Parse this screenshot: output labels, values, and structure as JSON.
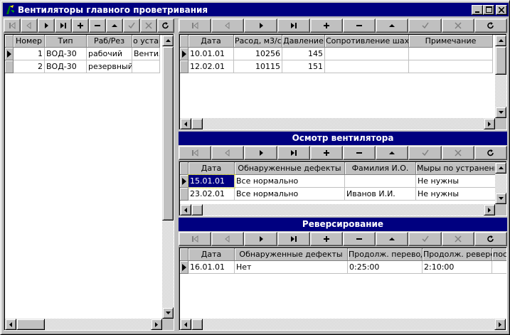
{
  "window": {
    "title": "Вентиляторы главного проветривания",
    "icon": "fan-app-icon",
    "controls": [
      "minimize-icon",
      "maximize-icon",
      "close-icon"
    ]
  },
  "nav_icons": [
    "first-record-icon",
    "prior-record-icon",
    "next-record-icon",
    "last-record-icon",
    "insert-record-icon",
    "delete-record-icon",
    "edit-record-icon",
    "post-edit-icon",
    "cancel-edit-icon",
    "refresh-icon"
  ],
  "fans": {
    "columns": [
      "Номер",
      "Тип",
      "Раб/Рез",
      "о установ"
    ],
    "rows": [
      [
        "1",
        "ВОД-30",
        "рабочий",
        "Вентил"
      ],
      [
        "2",
        "ВОД-30",
        "резервный",
        ""
      ]
    ]
  },
  "measurements": {
    "columns": [
      "Дата",
      "Расод, м3/с",
      "Давление",
      "Сопротивление шахты",
      "Примечание"
    ],
    "rows": [
      [
        "10.01.01",
        "10256",
        "145",
        "",
        ""
      ],
      [
        "12.02.01",
        "10115",
        "151",
        "",
        ""
      ]
    ]
  },
  "inspection": {
    "title": "Осмотр вентилятора",
    "columns": [
      "Дата",
      "Обнаруженные дефекты",
      "Фамилия И.О.",
      "Мыры по устранению"
    ],
    "rows": [
      [
        "15.01.01",
        "Все нормально",
        "",
        "Не нужны"
      ],
      [
        "23.02.01",
        "Все нормально",
        "Иванов И.И.",
        "Не нужны"
      ]
    ]
  },
  "reversal": {
    "title": "Реверсирование",
    "columns": [
      "Дата",
      "Обнаруженные дефекты",
      "Продолж. перевода",
      "Продолж. реверса",
      "пос"
    ],
    "rows": [
      [
        "16.01.01",
        "Нет",
        "0:25:00",
        "2:10:00",
        ""
      ]
    ]
  },
  "colors": {
    "titlebar": "#000080",
    "face": "#c0c0c0",
    "selection": "#000080"
  }
}
